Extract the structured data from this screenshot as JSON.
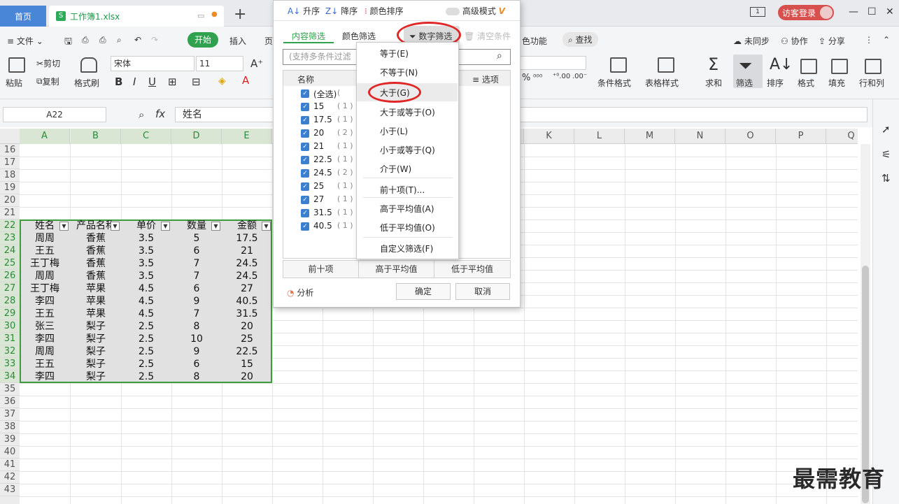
{
  "tabs": {
    "home": "首页",
    "file": "工作簿1.xlsx",
    "new_tab": "+"
  },
  "titlebar": {
    "login": "访客登录",
    "page_indicator": "1"
  },
  "menubar": {
    "file": "文件",
    "start": "开始",
    "insert": "插入",
    "page": "页",
    "extra": "色功能",
    "find": "查找",
    "sync": "未同步",
    "collab": "协作",
    "share": "分享"
  },
  "toolbar": {
    "paste": "粘贴",
    "cut": "剪切",
    "copy": "复制",
    "format_painter": "格式刷",
    "font": "宋体",
    "font_size": "11",
    "bold": "B",
    "italic": "I",
    "underline": "U",
    "cond_format": "条件格式",
    "table_style": "表格样式",
    "sum": "求和",
    "filter": "筛选",
    "sort": "排序",
    "format": "格式",
    "fill": "填充",
    "rowcol": "行和列"
  },
  "formula_bar": {
    "cell_ref": "A22",
    "fx": "fx",
    "value": "姓名"
  },
  "columns": [
    "A",
    "B",
    "C",
    "D",
    "E",
    "",
    "",
    "",
    "",
    "",
    "K",
    "L",
    "M",
    "N",
    "O",
    "P",
    "Q"
  ],
  "rows": [
    "16",
    "17",
    "18",
    "19",
    "20",
    "21",
    "22",
    "23",
    "24",
    "25",
    "26",
    "27",
    "28",
    "29",
    "30",
    "31",
    "32",
    "33",
    "34",
    "35",
    "36",
    "37",
    "38",
    "39",
    "40",
    "41",
    "42",
    "43"
  ],
  "table": {
    "headers": [
      "姓名",
      "产品名称",
      "单价",
      "数量",
      "金额"
    ],
    "rows": [
      [
        "周周",
        "香蕉",
        "3.5",
        "5",
        "17.5"
      ],
      [
        "王五",
        "香蕉",
        "3.5",
        "6",
        "21"
      ],
      [
        "王丁梅",
        "香蕉",
        "3.5",
        "7",
        "24.5"
      ],
      [
        "周周",
        "香蕉",
        "3.5",
        "7",
        "24.5"
      ],
      [
        "王丁梅",
        "苹果",
        "4.5",
        "6",
        "27"
      ],
      [
        "李四",
        "苹果",
        "4.5",
        "9",
        "40.5"
      ],
      [
        "王五",
        "苹果",
        "4.5",
        "7",
        "31.5"
      ],
      [
        "张三",
        "梨子",
        "2.5",
        "8",
        "20"
      ],
      [
        "李四",
        "梨子",
        "2.5",
        "10",
        "25"
      ],
      [
        "周周",
        "梨子",
        "2.5",
        "9",
        "22.5"
      ],
      [
        "王五",
        "梨子",
        "2.5",
        "6",
        "15"
      ],
      [
        "李四",
        "梨子",
        "2.5",
        "8",
        "20"
      ]
    ]
  },
  "filter_panel": {
    "sort_asc": "升序",
    "sort_desc": "降序",
    "color_sort": "颜色排序",
    "advanced": "高级模式",
    "tab_content": "内容筛选",
    "tab_color": "颜色筛选",
    "tab_number": "数字筛选",
    "clear": "清空条件",
    "search_placeholder": "(支持多条件过滤",
    "list_header": "名称",
    "options": "选项",
    "items": [
      {
        "label": "(全选)",
        "count": "("
      },
      {
        "label": "15",
        "count": "( 1 )"
      },
      {
        "label": "17.5",
        "count": "( 1 )"
      },
      {
        "label": "20",
        "count": "( 2 )"
      },
      {
        "label": "21",
        "count": "( 1 )"
      },
      {
        "label": "22.5",
        "count": "( 1 )"
      },
      {
        "label": "24.5",
        "count": "( 2 )"
      },
      {
        "label": "25",
        "count": "( 1 )"
      },
      {
        "label": "27",
        "count": "( 1 )"
      },
      {
        "label": "31.5",
        "count": "( 1 )"
      },
      {
        "label": "40.5",
        "count": "( 1 )"
      }
    ],
    "quick": [
      "前十项",
      "高于平均值",
      "低于平均值"
    ],
    "analysis": "分析",
    "ok": "确定",
    "cancel": "取消"
  },
  "number_filter_menu": [
    "等于(E)",
    "不等于(N)",
    "大于(G)",
    "大于或等于(O)",
    "小于(L)",
    "小于或等于(Q)",
    "介于(W)",
    "前十项(T)...",
    "高于平均值(A)",
    "低于平均值(O)",
    "自定义筛选(F)"
  ],
  "watermark": "最需教育",
  "colors": {
    "accent_green": "#30a14e",
    "highlight_red": "#e02727",
    "tab_blue": "#4a86d8"
  }
}
